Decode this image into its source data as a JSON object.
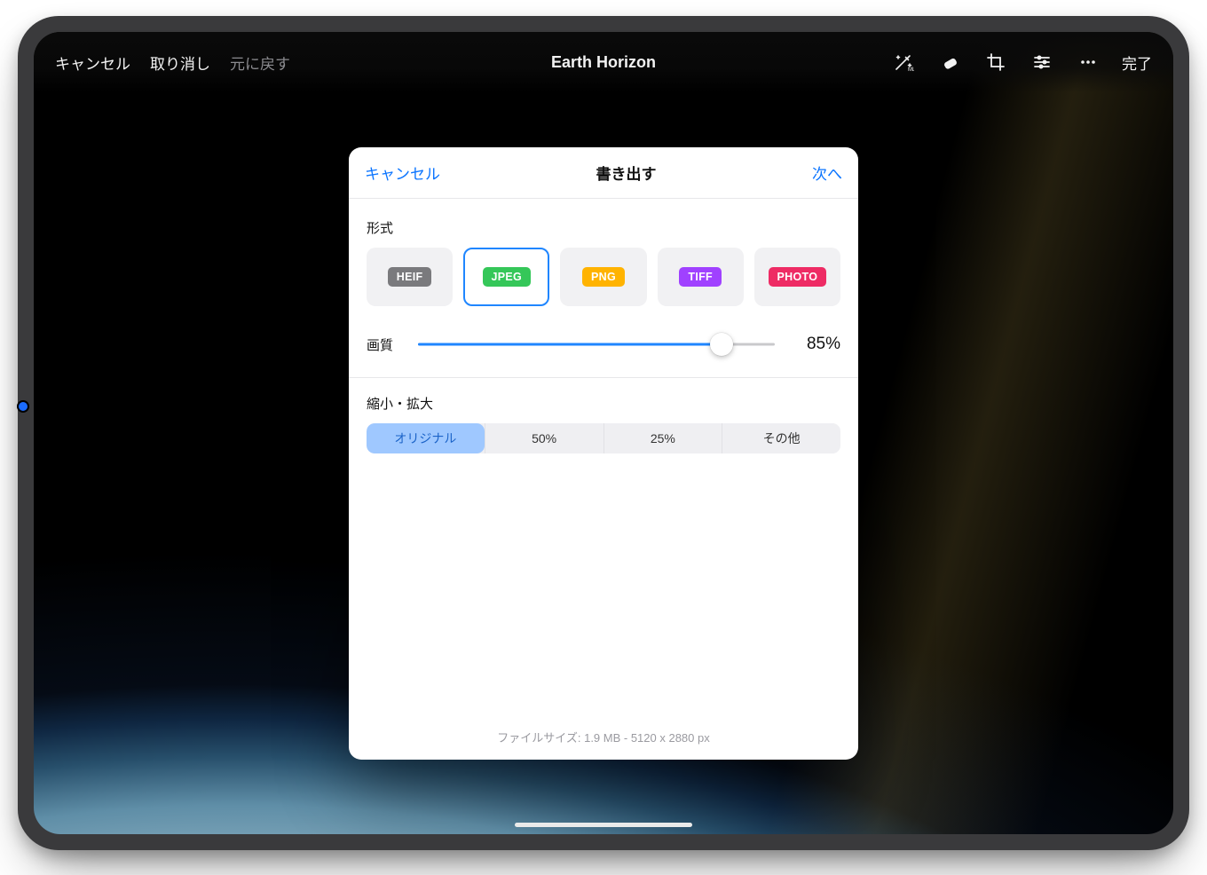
{
  "toolbar": {
    "cancel": "キャンセル",
    "undo": "取り消し",
    "redo": "元に戻す",
    "title": "Earth Horizon",
    "done": "完了"
  },
  "modal": {
    "cancel": "キャンセル",
    "title": "書き出す",
    "next": "次へ",
    "format_label": "形式",
    "formats": {
      "heif": "HEIF",
      "jpeg": "JPEG",
      "png": "PNG",
      "tiff": "TIFF",
      "photo": "PHOTO"
    },
    "selected_format": "JPEG",
    "quality_label": "画質",
    "quality_percent": "85%",
    "quality_value": 85,
    "scale_label": "縮小・拡大",
    "scale_options": {
      "original": "オリジナル",
      "50": "50%",
      "25": "25%",
      "other": "その他"
    },
    "file_info": "ファイルサイズ: 1.9 MB - 5120 x 2880 px"
  }
}
